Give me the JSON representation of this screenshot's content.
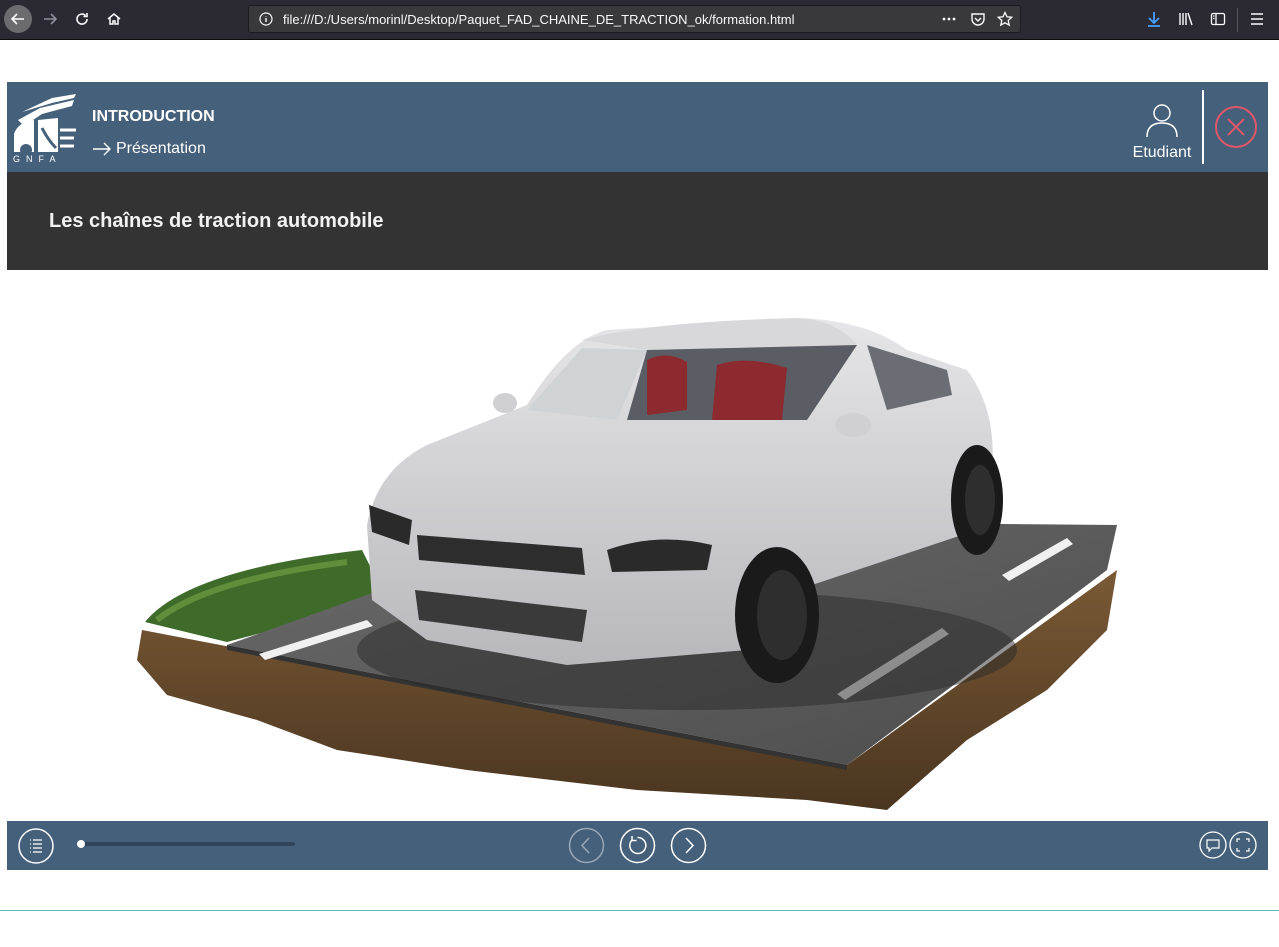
{
  "browser": {
    "url": "file:///D:/Users/morinl/Desktop/Paquet_FAD_CHAINE_DE_TRACTION_ok/formation.html",
    "icons": [
      "back-icon",
      "forward-icon",
      "reload-icon",
      "home-icon",
      "info-icon",
      "more-icon",
      "pocket-icon",
      "star-icon",
      "download-icon",
      "library-icon",
      "sidebar-icon",
      "menu-icon"
    ]
  },
  "header": {
    "logo_text": "GNFA",
    "chapter": "INTRODUCTION",
    "section": "Présentation",
    "user_label": "Etudiant"
  },
  "content": {
    "title": "Les chaînes de traction automobile"
  },
  "footer": {
    "progress": 0.02
  },
  "colors": {
    "header_bg": "#44607a",
    "title_bg": "#333333",
    "close_accent": "#e0566a"
  }
}
